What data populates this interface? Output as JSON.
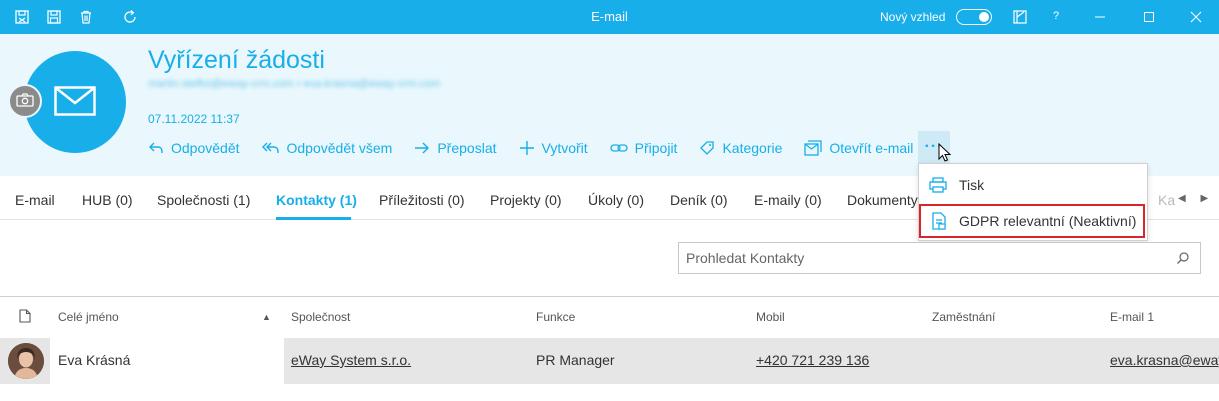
{
  "window": {
    "title": "E-mail",
    "new_look_label": "Nový vzhled",
    "help_label": "?",
    "icons": [
      "save-close-icon",
      "save-icon",
      "delete-icon",
      "refresh-icon",
      "layout-icon",
      "help-icon",
      "minimize-icon",
      "maximize-icon",
      "close-icon"
    ]
  },
  "header": {
    "subject": "Vyřízení žádosti",
    "addresses": "martin.stefko@eway-crm.com • eva.krasna@eway-crm.com",
    "date": "07.11.2022 11:37",
    "actions": [
      {
        "label": "Odpovědět",
        "icon": "reply-icon"
      },
      {
        "label": "Odpovědět všem",
        "icon": "reply-all-icon"
      },
      {
        "label": "Přeposlat",
        "icon": "forward-icon"
      },
      {
        "label": "Vytvořit",
        "icon": "plus-icon"
      },
      {
        "label": "Připojit",
        "icon": "link-icon"
      },
      {
        "label": "Kategorie",
        "icon": "tag-icon"
      },
      {
        "label": "Otevřít e-mail",
        "icon": "open-email-icon"
      }
    ],
    "more_label": "···"
  },
  "dropdown": {
    "items": [
      {
        "label": "Tisk",
        "icon": "printer-icon"
      },
      {
        "label": "GDPR relevantní (Neaktivní)",
        "icon": "gdpr-icon"
      }
    ]
  },
  "tabs": {
    "items": [
      {
        "label": "E-mail"
      },
      {
        "label": "HUB (0)"
      },
      {
        "label": "Společnosti (1)"
      },
      {
        "label": "Kontakty (1)",
        "active": true
      },
      {
        "label": "Příležitosti (0)"
      },
      {
        "label": "Projekty (0)"
      },
      {
        "label": "Úkoly (0)"
      },
      {
        "label": "Deník (0)"
      },
      {
        "label": "E-maily (0)"
      },
      {
        "label": "Dokumenty"
      }
    ],
    "overflow_label": "Ka",
    "scroll_arrows": "◀ ▶"
  },
  "search": {
    "placeholder": "Prohledat Kontakty"
  },
  "grid": {
    "columns": [
      "Celé jméno",
      "Společnost",
      "Funkce",
      "Mobil",
      "Zaměstnání",
      "E-mail 1"
    ],
    "sort_indicator": "▲",
    "rows": [
      {
        "name": "Eva Krásná",
        "company": "eWay System s.r.o.",
        "function": "PR Manager",
        "mobile": "+420 721 239 136",
        "employment": "",
        "email": "eva.krasna@eway-crm.com"
      }
    ]
  },
  "colors": {
    "accent": "#17aeea",
    "header_bg": "#eaf8fd",
    "highlight_border": "#d9252a"
  }
}
